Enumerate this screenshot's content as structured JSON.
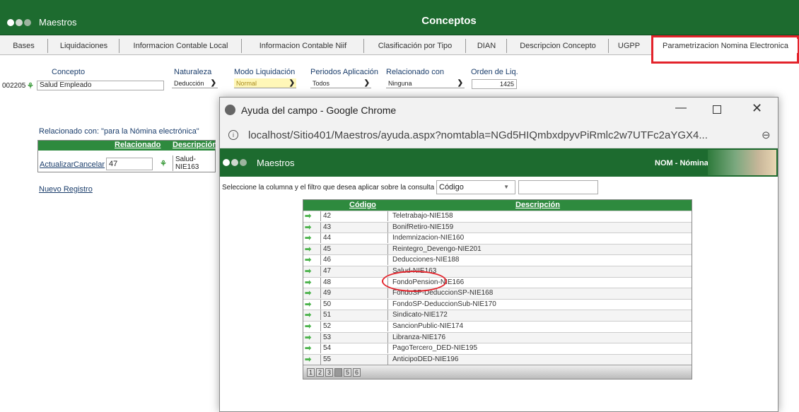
{
  "app": {
    "brand": "Maestros",
    "title": "Conceptos"
  },
  "tabs": [
    "Bases",
    "Liquidaciones",
    "Informacion Contable Local",
    "Informacion Contable Niif",
    "Clasificación por Tipo",
    "DIAN",
    "Descripcion Concepto",
    "UGPP",
    "Parametrizacion Nomina Electronica"
  ],
  "form": {
    "concepto_label": "Concepto",
    "concepto_code": "002205",
    "concepto_value": "Salud Empleado",
    "naturaleza_label": "Naturaleza",
    "naturaleza_value": "Deducción",
    "modo_label": "Modo Liquidación",
    "modo_value": "Normal",
    "periodos_label": "Periodos Aplicación",
    "periodos_value": "Todos",
    "relacionado_label": "Relacionado con",
    "relacionado_value": "Ninguna",
    "orden_label": "Orden de Liq.",
    "orden_value": "1425"
  },
  "related": {
    "title": "Relacionado con: \"para la Nómina electrónica\"",
    "col_relacionado": "Relacionado",
    "col_descripcion": "Descripción",
    "actualizar": "Actualizar",
    "cancelar": "Cancelar",
    "value": "47",
    "desc_line1": "Salud-",
    "desc_line2": "NIE163",
    "nuevo": "Nuevo Registro"
  },
  "popup": {
    "window_title": "Ayuda del campo - Google Chrome",
    "url": "localhost/Sitio401/Maestros/ayuda.aspx?nomtabla=NGd5HIQmbxdpyvPiRmlc2w7UTFc2aYGX4...",
    "brand": "Maestros",
    "nom": "NOM - Nómina",
    "filter_label": "Seleccione la columna y el filtro que desea aplicar sobre la consulta",
    "filter_select": "Código",
    "col_codigo": "Código",
    "col_descripcion": "Descripción",
    "rows": [
      {
        "code": "42",
        "desc": "Teletrabajo-NIE158"
      },
      {
        "code": "43",
        "desc": "BonifRetiro-NIE159"
      },
      {
        "code": "44",
        "desc": "Indemnizacion-NIE160"
      },
      {
        "code": "45",
        "desc": "Reintegro_Devengo-NIE201"
      },
      {
        "code": "46",
        "desc": "Deducciones-NIE188"
      },
      {
        "code": "47",
        "desc": "Salud-NIE163"
      },
      {
        "code": "48",
        "desc": "FondoPension-NIE166"
      },
      {
        "code": "49",
        "desc": "FondoSP-DeduccionSP-NIE168"
      },
      {
        "code": "50",
        "desc": "FondoSP-DeduccionSub-NIE170"
      },
      {
        "code": "51",
        "desc": "Sindicato-NIE172"
      },
      {
        "code": "52",
        "desc": "SancionPublic-NIE174"
      },
      {
        "code": "53",
        "desc": "Libranza-NIE176"
      },
      {
        "code": "54",
        "desc": "PagoTercero_DED-NIE195"
      },
      {
        "code": "55",
        "desc": "AnticipoDED-NIE196"
      }
    ],
    "pages": [
      "1",
      "2",
      "3",
      "4",
      "5",
      "6"
    ],
    "current_page": "4"
  },
  "colors": {
    "green_bar": "#1d6b2f",
    "grid_header": "#2e8a3e",
    "highlight": "#e3232b"
  }
}
